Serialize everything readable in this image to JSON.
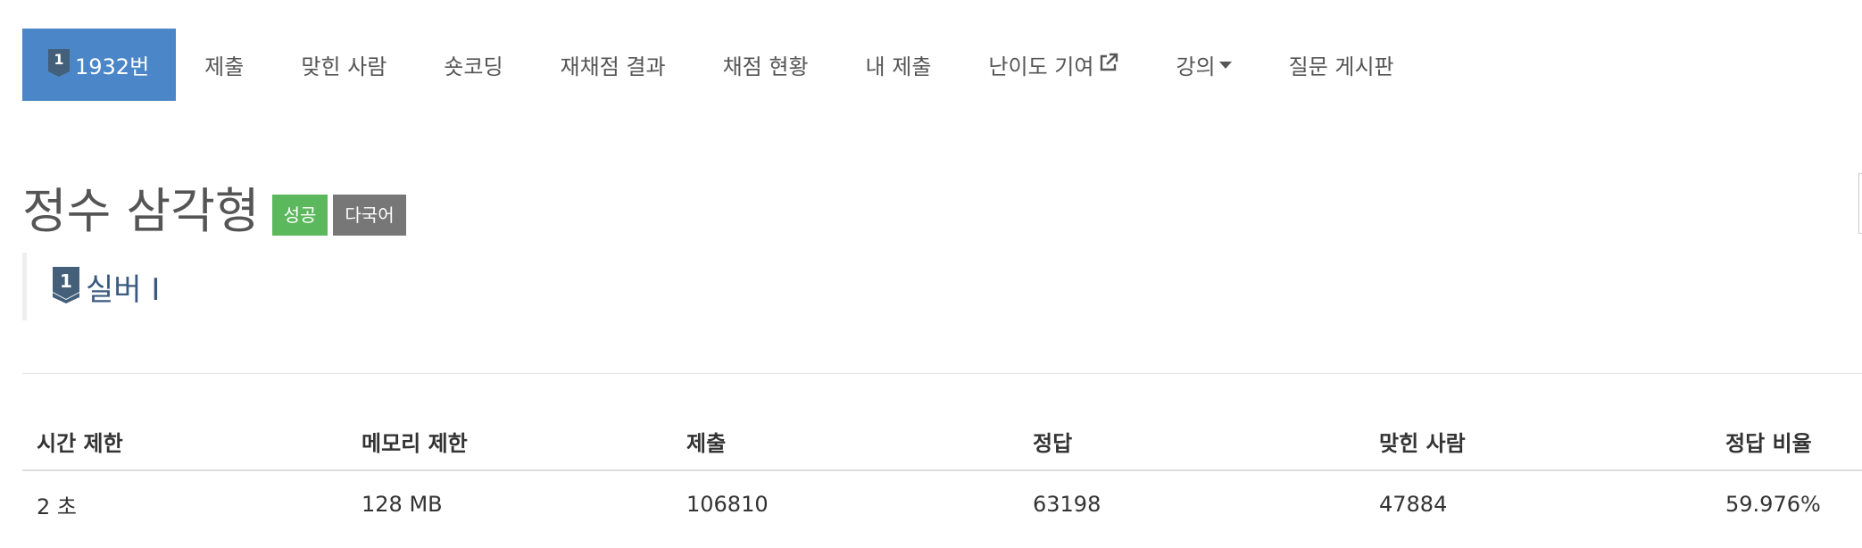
{
  "nav": {
    "problem_number": "1932번",
    "tabs": [
      {
        "label": "제출"
      },
      {
        "label": "맞힌 사람"
      },
      {
        "label": "숏코딩"
      },
      {
        "label": "재채점 결과"
      },
      {
        "label": "채점 현황"
      },
      {
        "label": "내 제출"
      },
      {
        "label": "난이도 기여",
        "icon": "external-link-icon"
      },
      {
        "label": "강의",
        "icon": "caret-down-icon"
      },
      {
        "label": "질문 게시판"
      }
    ]
  },
  "problem": {
    "title": "정수 삼각형",
    "labels": [
      {
        "text": "성공",
        "color": "#5cb85c"
      },
      {
        "text": "다국어",
        "color": "#777777"
      }
    ],
    "tier": {
      "text": "실버 I",
      "level": "1",
      "color": "#435f7a"
    }
  },
  "info_table": {
    "headers": [
      "시간 제한",
      "메모리 제한",
      "제출",
      "정답",
      "맞힌 사람",
      "정답 비율"
    ],
    "row": [
      "2 초",
      "128 MB",
      "106810",
      "63198",
      "47884",
      "59.976%"
    ]
  },
  "colors": {
    "active_tab": "#4a86c8",
    "tier_badge": "#435f7a"
  }
}
